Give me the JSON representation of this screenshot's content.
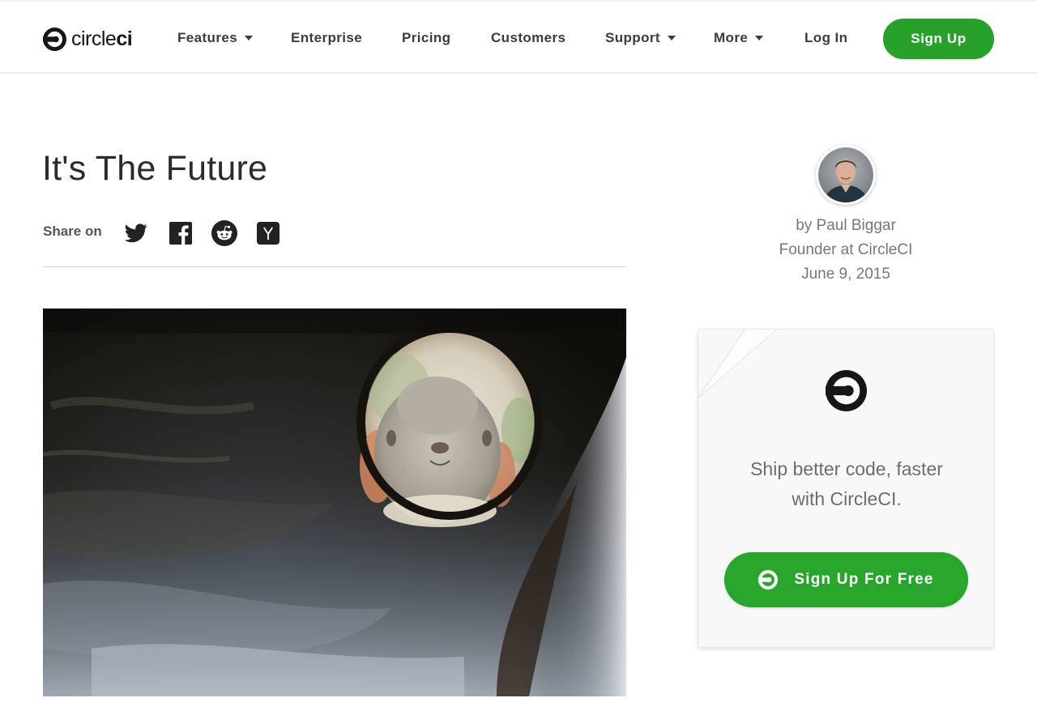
{
  "brand": {
    "logo_light": "circle",
    "logo_bold": "ci",
    "logo_icon": "circleci-logo-icon",
    "green": "#27a129"
  },
  "nav": {
    "items": [
      {
        "label": "Features",
        "dropdown": true
      },
      {
        "label": "Enterprise",
        "dropdown": false
      },
      {
        "label": "Pricing",
        "dropdown": false
      },
      {
        "label": "Customers",
        "dropdown": false
      },
      {
        "label": "Support",
        "dropdown": true
      },
      {
        "label": "More",
        "dropdown": true
      }
    ],
    "login_label": "Log In",
    "signup_label": "Sign Up"
  },
  "article": {
    "title": "It's The Future",
    "share_label": "Share on",
    "share_icons": [
      "twitter-icon",
      "facebook-icon",
      "reddit-icon",
      "hacker-news-icon"
    ],
    "hero_image": "rabbit-in-log-image"
  },
  "author": {
    "byline": "by Paul Biggar",
    "role": "Founder at CircleCI",
    "date": "June 9, 2015"
  },
  "promo": {
    "line1": "Ship better code, faster",
    "line2": "with CircleCI.",
    "button_label": "Sign Up For Free"
  }
}
